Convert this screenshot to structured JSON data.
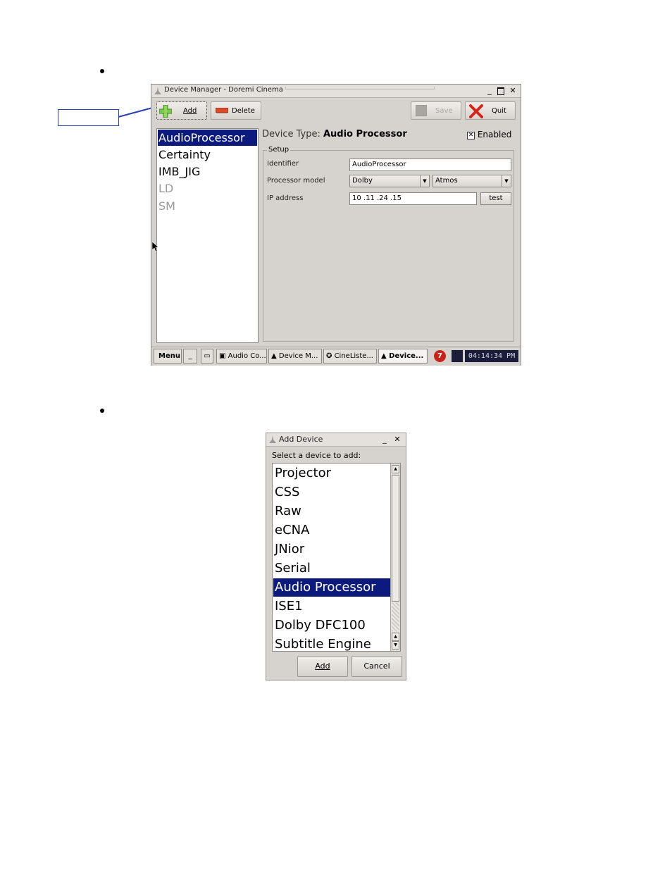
{
  "device_manager": {
    "title": "Device Manager - Doremi Cinema",
    "toolbar": {
      "add_label": "Add",
      "delete_label": "Delete",
      "save_label": "Save",
      "quit_label": "Quit"
    },
    "devices": [
      {
        "label": "AudioProcessor"
      },
      {
        "label": "Certainty"
      },
      {
        "label": "IMB_JIG"
      },
      {
        "label": "LD"
      },
      {
        "label": "SM"
      }
    ],
    "device_type_prefix": "Device Type:",
    "device_type_value": "Audio Processor",
    "enabled_label": "Enabled",
    "setup_legend": "Setup",
    "identifier_label": "Identifier",
    "identifier_value": "AudioProcessor",
    "processor_model_label": "Processor model",
    "processor_brand": "Dolby",
    "processor_model": "Atmos",
    "ip_label": "IP address",
    "ip_value": "10 .11 .24 .15",
    "test_label": "test"
  },
  "taskbar": {
    "menu_label": "Menu",
    "tasks": [
      {
        "label": "Audio Co..."
      },
      {
        "label": "Device M..."
      },
      {
        "label": "CineListe..."
      },
      {
        "label": "Device..."
      }
    ],
    "badge_count": "7",
    "clock": "04:14:34 PM"
  },
  "add_device": {
    "title": "Add Device",
    "prompt": "Select a device to add:",
    "options": [
      {
        "label": "Projector"
      },
      {
        "label": "CSS"
      },
      {
        "label": "Raw"
      },
      {
        "label": "eCNA"
      },
      {
        "label": "JNior"
      },
      {
        "label": "Serial"
      },
      {
        "label": "Audio Processor"
      },
      {
        "label": "ISE1"
      },
      {
        "label": "Dolby DFC100"
      },
      {
        "label": "Subtitle Engine"
      }
    ],
    "add_label": "Add",
    "cancel_label": "Cancel"
  },
  "colors": {
    "selection": "#0b1a7c",
    "window_bg": "#d6d3ce",
    "callout": "#2b3fb0"
  }
}
